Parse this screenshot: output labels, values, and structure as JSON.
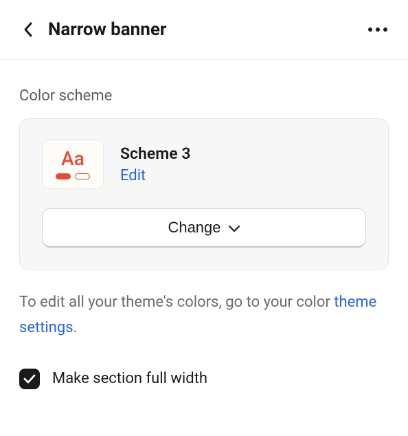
{
  "header": {
    "title": "Narrow banner"
  },
  "colorScheme": {
    "label": "Color scheme",
    "swatchText": "Aa",
    "name": "Scheme 3",
    "editLabel": "Edit",
    "changeLabel": "Change"
  },
  "helper": {
    "prefix": "To edit all your theme's colors, go to your color ",
    "linkText": "theme settings",
    "suffix": "."
  },
  "fullWidth": {
    "label": "Make section full width",
    "checked": true
  }
}
